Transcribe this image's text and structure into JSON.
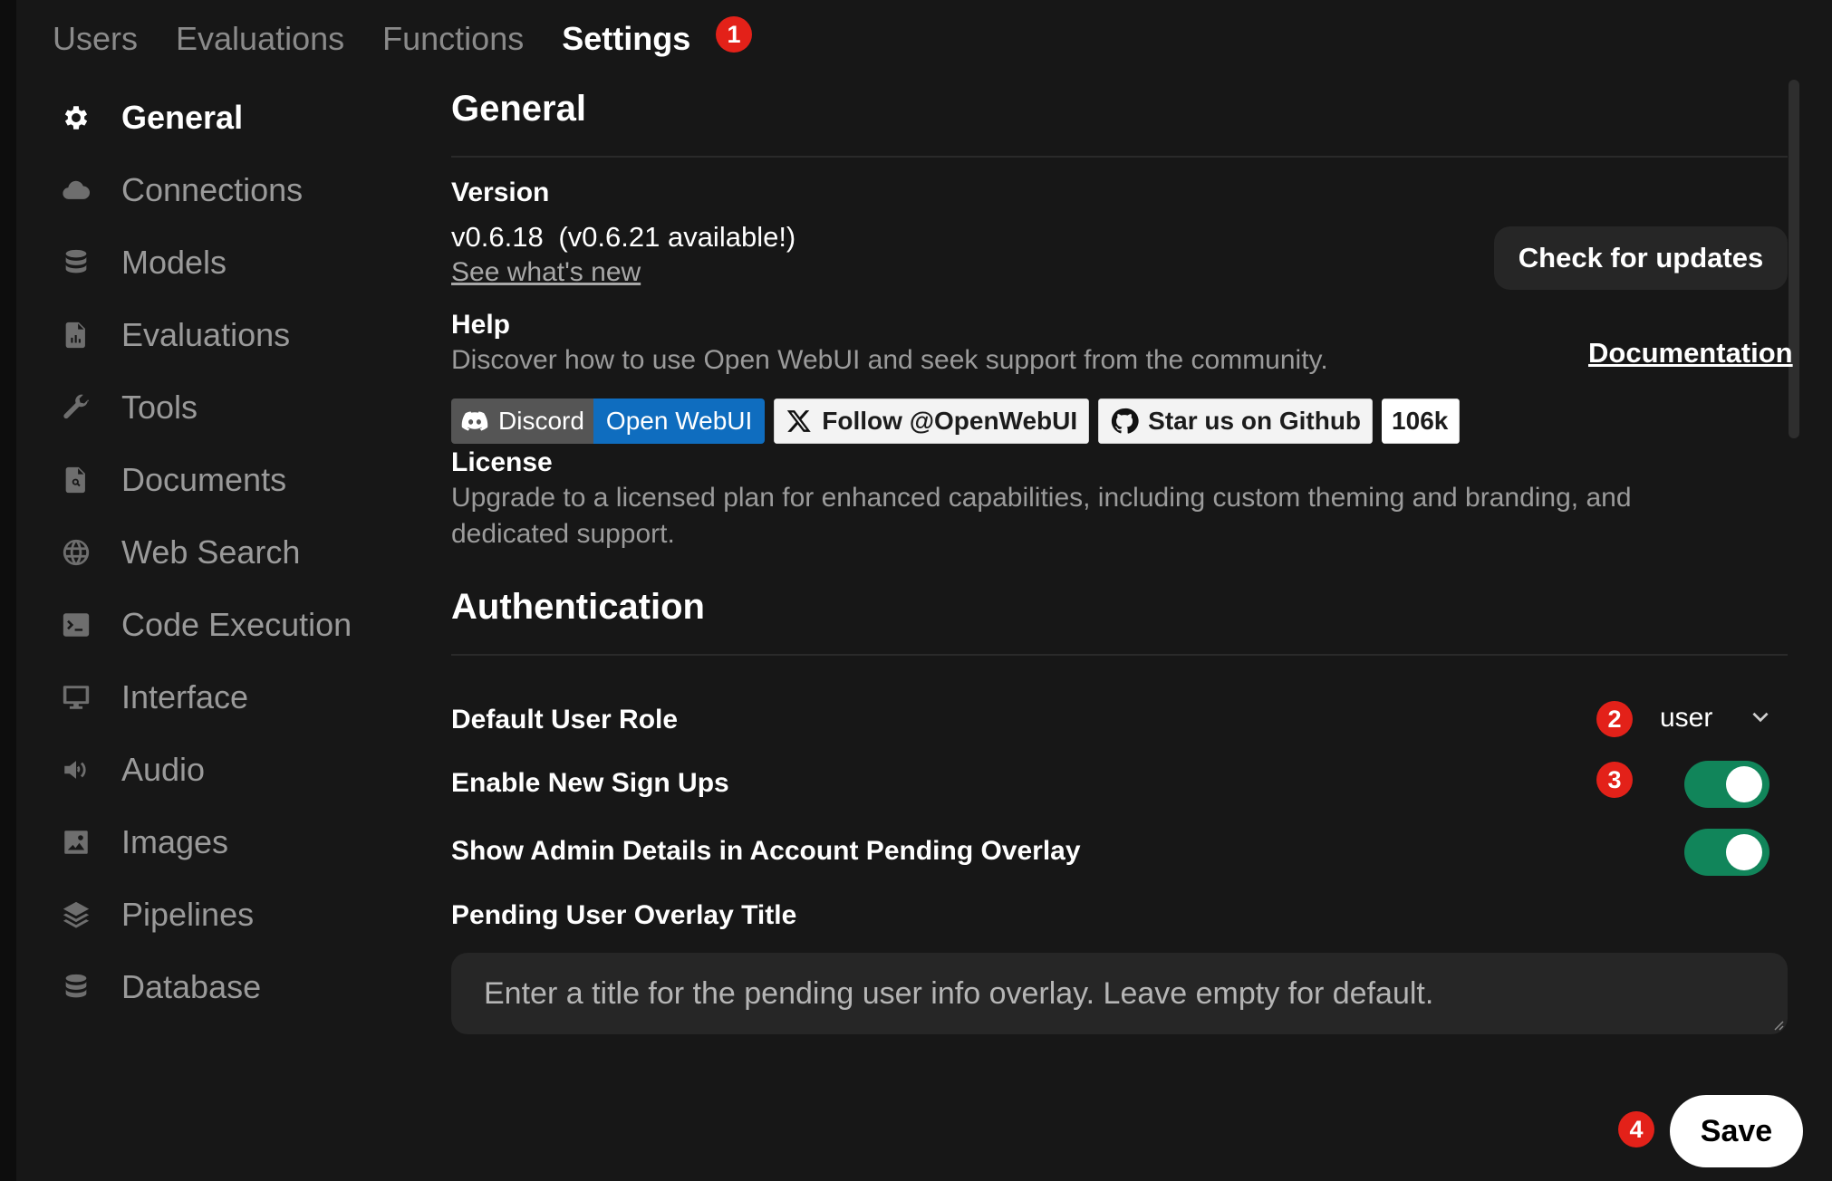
{
  "tabs": [
    "Users",
    "Evaluations",
    "Functions",
    "Settings"
  ],
  "active_tab": "Settings",
  "step_badges": [
    "1",
    "2",
    "3",
    "4"
  ],
  "sidebar": {
    "items": [
      {
        "label": "General",
        "icon": "gear-icon"
      },
      {
        "label": "Connections",
        "icon": "cloud-icon"
      },
      {
        "label": "Models",
        "icon": "database-icon"
      },
      {
        "label": "Evaluations",
        "icon": "document-chart-icon"
      },
      {
        "label": "Tools",
        "icon": "wrench-icon"
      },
      {
        "label": "Documents",
        "icon": "document-search-icon"
      },
      {
        "label": "Web Search",
        "icon": "globe-icon"
      },
      {
        "label": "Code Execution",
        "icon": "terminal-icon"
      },
      {
        "label": "Interface",
        "icon": "monitor-icon"
      },
      {
        "label": "Audio",
        "icon": "speaker-icon"
      },
      {
        "label": "Images",
        "icon": "image-icon"
      },
      {
        "label": "Pipelines",
        "icon": "layers-icon"
      },
      {
        "label": "Database",
        "icon": "database-icon"
      }
    ]
  },
  "general": {
    "title": "General",
    "version_label": "Version",
    "version_value": "v0.6.18",
    "version_available": "(v0.6.21 available!)",
    "whats_new": "See what's new",
    "check_updates": "Check for updates",
    "help_label": "Help",
    "help_desc": "Discover how to use Open WebUI and seek support from the community.",
    "documentation": "Documentation",
    "license_label": "License",
    "license_desc": "Upgrade to a licensed plan for enhanced capabilities, including custom theming and branding, and dedicated support."
  },
  "social": {
    "discord_left": "Discord",
    "discord_right": "Open WebUI",
    "twitter": "Follow @OpenWebUI",
    "github": "Star us on Github",
    "github_count": "106k"
  },
  "auth": {
    "title": "Authentication",
    "default_role_label": "Default User Role",
    "default_role_value": "user",
    "signups_label": "Enable New Sign Ups",
    "signups_enabled": true,
    "admin_details_label": "Show Admin Details in Account Pending Overlay",
    "admin_details_enabled": true,
    "overlay_title_label": "Pending User Overlay Title",
    "overlay_title_placeholder": "Enter a title for the pending user info overlay. Leave empty for default."
  },
  "save_label": "Save",
  "colors": {
    "background": "#171717",
    "toggle_on": "#11855a",
    "badge": "#e32119",
    "discord_blue": "#0f6dbf"
  }
}
